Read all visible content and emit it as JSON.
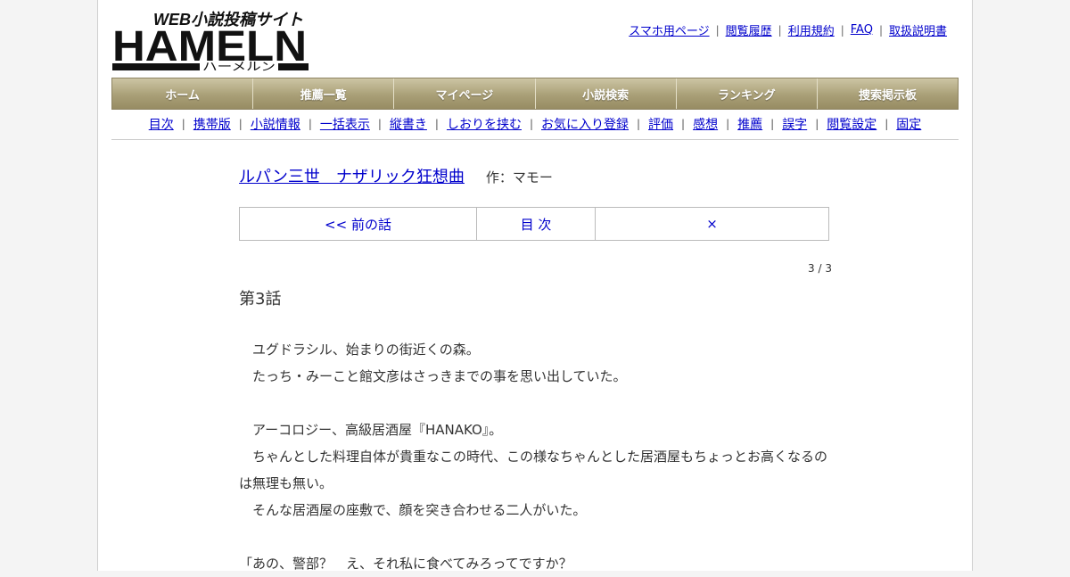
{
  "logo": {
    "tagline": "WEB小説投稿サイト",
    "wordmark": "HAMELN",
    "kana": "ハーメルン"
  },
  "top_links": [
    "スマホ用ページ",
    "閲覧履歴",
    "利用規約",
    "FAQ",
    "取扱説明書"
  ],
  "main_nav": [
    "ホーム",
    "推薦一覧",
    "マイページ",
    "小説検索",
    "ランキング",
    "捜索掲示板"
  ],
  "sub_nav": [
    "目次",
    "携帯版",
    "小説情報",
    "一括表示",
    "縦書き",
    "しおりを挟む",
    "お気に入り登録",
    "評価",
    "感想",
    "推薦",
    "誤字",
    "閲覧設定",
    "固定"
  ],
  "novel": {
    "title": "ルパン三世　ナザリック狂想曲",
    "author": "作：マモー"
  },
  "chapter_nav": {
    "prev": "<< 前の話",
    "toc": "目 次",
    "close": "×"
  },
  "page_count": "3 / 3",
  "chapter_title": "第3話",
  "paragraphs": [
    "　ユグドラシル、始まりの街近くの森。",
    "　たっち・みーこと館文彦はさっきまでの事を思い出していた。",
    "",
    "　アーコロジー、高級居酒屋『HANAKO』。",
    "　ちゃんとした料理自体が貴重なこの時代、この様なちゃんとした居酒屋もちょっとお高くなるのは無理も無い。",
    "　そんな居酒屋の座敷で、顔を突き合わせる二人がいた。",
    "",
    "「あの、警部？　え、それ私に食べてみろってですか？"
  ]
}
